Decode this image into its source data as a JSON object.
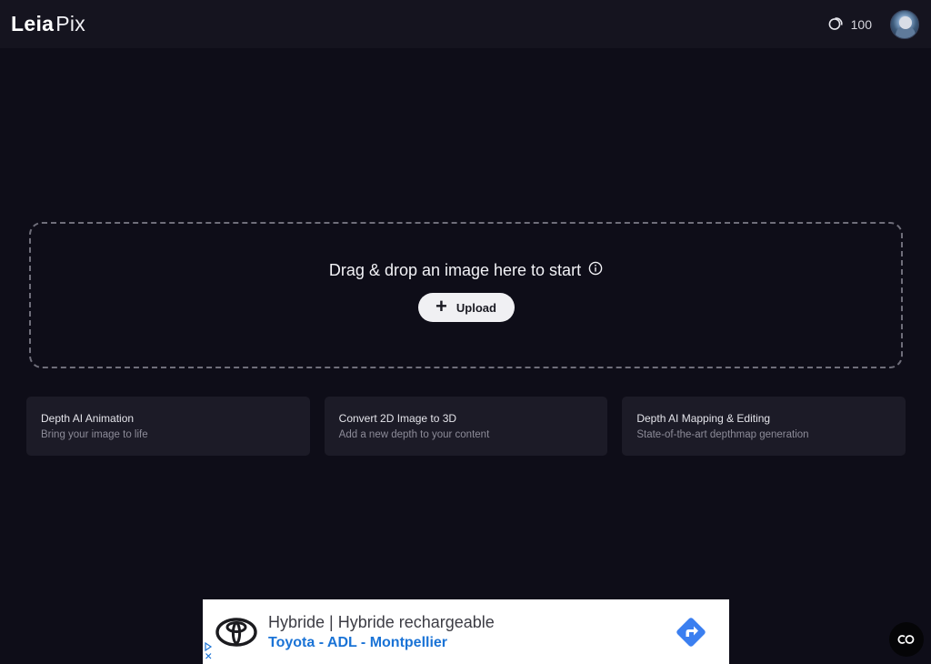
{
  "header": {
    "logo_primary": "Leia",
    "logo_secondary": "Pix",
    "credits": "100"
  },
  "dropzone": {
    "title": "Drag & drop an image here to start",
    "upload_label": "Upload"
  },
  "features": [
    {
      "title": "Depth AI Animation",
      "subtitle": "Bring your image to life"
    },
    {
      "title": "Convert 2D Image to 3D",
      "subtitle": "Add a new depth to your content"
    },
    {
      "title": "Depth AI Mapping & Editing",
      "subtitle": "State-of-the-art depthmap generation"
    }
  ],
  "ad": {
    "headline": "Hybride | Hybride rechargeable",
    "subline": "Toyota - ADL - Montpellier",
    "brand_icon": "toyota-logo",
    "cta_icon": "directions-arrow-icon",
    "cta_color": "#3b7ff0"
  },
  "colors": {
    "background": "#0e0d18",
    "header": "#15141f",
    "card": "#1c1b27",
    "upload_button": "#f0f0f3"
  },
  "icons": {
    "credits": "coins-icon",
    "info": "info-icon",
    "upload": "plus-icon",
    "floating": "cc-icon"
  }
}
